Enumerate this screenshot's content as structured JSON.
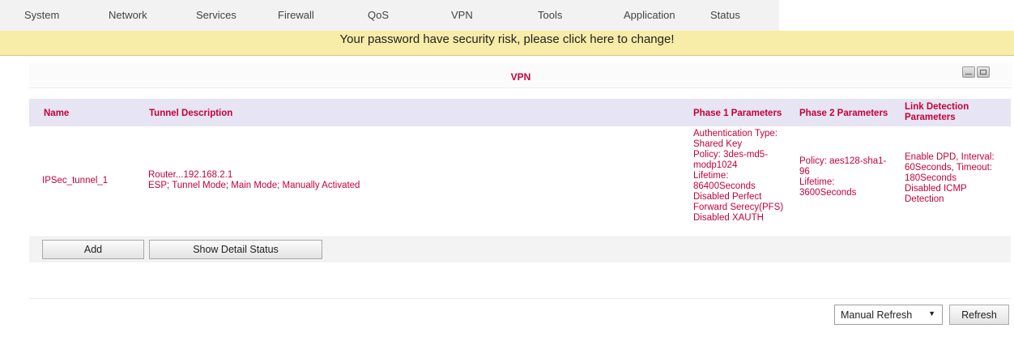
{
  "nav": {
    "items": [
      "System",
      "Network",
      "Services",
      "Firewall",
      "QoS",
      "VPN",
      "Tools",
      "Application",
      "Status"
    ]
  },
  "warning": {
    "text": "Your password have security risk, please click here to change!"
  },
  "panel": {
    "title": "VPN"
  },
  "table": {
    "columns": {
      "name": "Name",
      "description": "Tunnel Description",
      "phase1": "Phase 1 Parameters",
      "phase2": "Phase 2 Parameters",
      "link_line1": "Link Detection",
      "link_line2": "Parameters"
    },
    "rows": [
      {
        "name": "IPSec_tunnel_1",
        "desc_line1": "Router...192.168.2.1",
        "desc_line2": "ESP; Tunnel Mode; Main Mode; Manually Activated",
        "phase1": [
          "Authentication Type:",
          "Shared Key",
          "Policy: 3des-md5-",
          "modp1024",
          "Lifetime:",
          "86400Seconds",
          "Disabled Perfect",
          "Forward Serecy(PFS)",
          "Disabled XAUTH"
        ],
        "phase2": [
          "Policy: aes128-sha1-",
          "96",
          "Lifetime:",
          "3600Seconds"
        ],
        "link": [
          "Enable DPD, Interval:",
          "60Seconds, Timeout:",
          "180Seconds",
          "Disabled ICMP",
          "Detection"
        ]
      }
    ]
  },
  "buttons": {
    "add": "Add",
    "show_detail": "Show Detail Status",
    "refresh": "Refresh"
  },
  "refresh_mode": {
    "selected": "Manual Refresh"
  }
}
